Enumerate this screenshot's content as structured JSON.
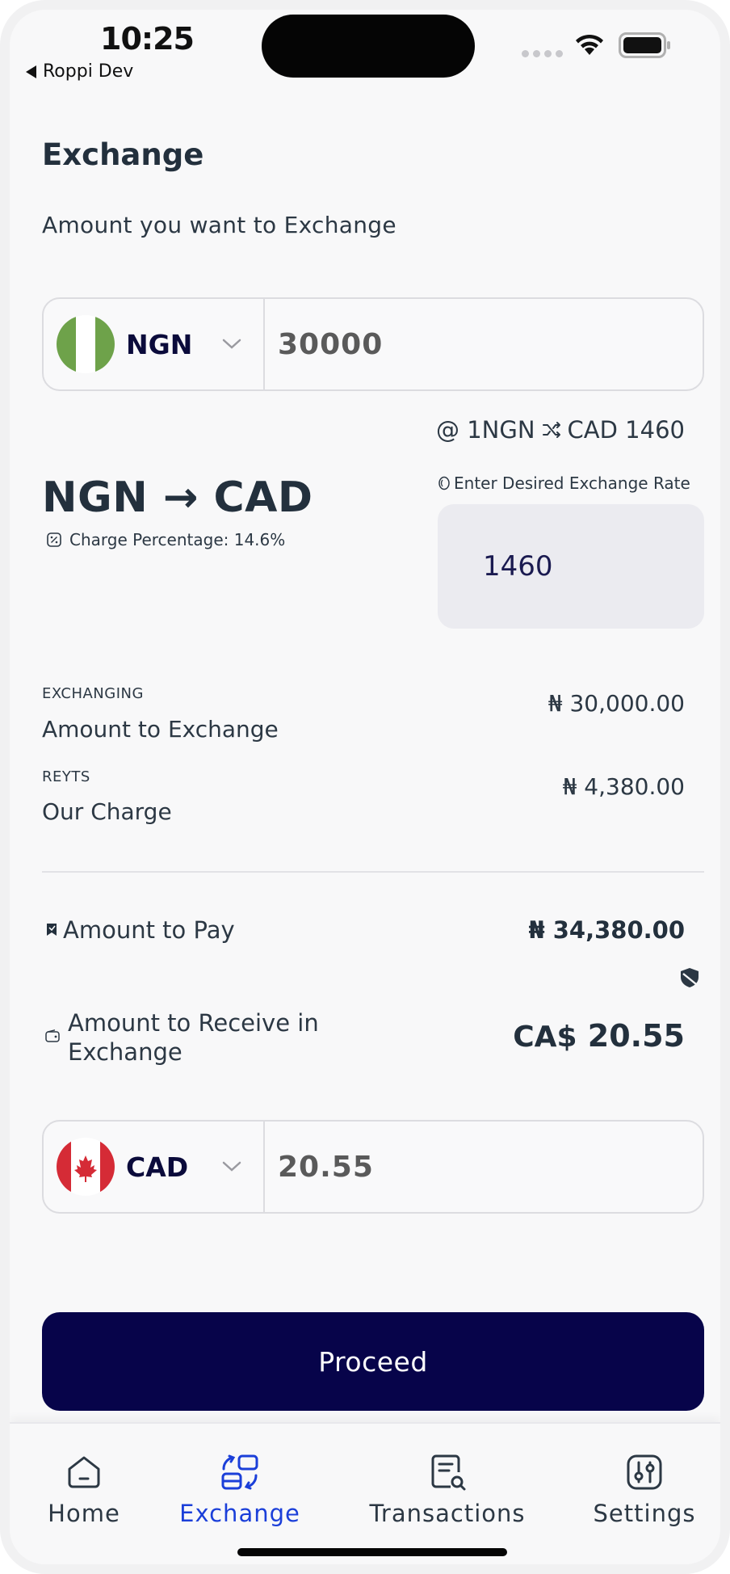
{
  "status_bar": {
    "time": "10:25",
    "back_label": "Roppi Dev"
  },
  "page": {
    "title": "Exchange",
    "subtitle": "Amount you want to Exchange"
  },
  "from": {
    "currency": "NGN",
    "amount": "30000"
  },
  "rate_line": {
    "prefix": "@ 1NGN",
    "suffix": "CAD 1460"
  },
  "pair": {
    "label": "NGN → CAD"
  },
  "charge_percentage": "Charge Percentage: 14.6%",
  "desired_rate": {
    "label": "Enter Desired Exchange Rate",
    "value": "1460"
  },
  "breakdown": [
    {
      "tag": "EXCHANGING",
      "label": "Amount to Exchange",
      "value": "₦ 30,000.00"
    },
    {
      "tag": "REYTS",
      "label": "Our Charge",
      "value": "₦ 4,380.00"
    }
  ],
  "pay": {
    "label": "Amount to Pay",
    "value": "₦ 34,380.00"
  },
  "receive": {
    "label_line1": "Amount to Receive in",
    "label_line2": "Exchange",
    "currency_prefix": "CA$",
    "value": "20.55"
  },
  "to": {
    "currency": "CAD",
    "amount": "20.55"
  },
  "proceed_label": "Proceed",
  "tabs": [
    {
      "label": "Home",
      "icon": "home-icon"
    },
    {
      "label": "Exchange",
      "icon": "exchange-icon",
      "active": true
    },
    {
      "label": "Transactions",
      "icon": "transactions-icon"
    },
    {
      "label": "Settings",
      "icon": "settings-icon"
    }
  ],
  "colors": {
    "primary": "#07044a",
    "active_tab": "#1b3fd9",
    "text": "#23303d",
    "input_bg": "#ebebf0"
  }
}
